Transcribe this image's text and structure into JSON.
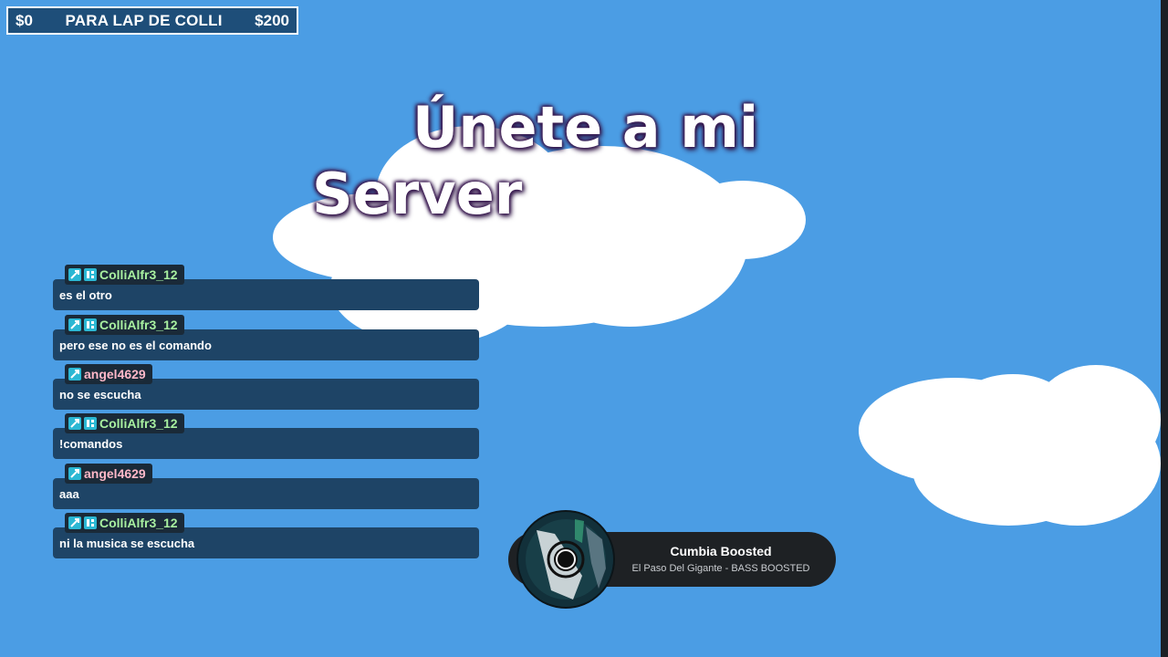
{
  "goal": {
    "current": "$0",
    "title": "PARA LAP DE COLLI",
    "target": "$200"
  },
  "headline": {
    "line1": "Únete a mi",
    "line2": "Server"
  },
  "chat": {
    "messages": [
      {
        "user": "ColliAlfr3_12",
        "text": "es el otro",
        "user_color": "#a8f0a0"
      },
      {
        "user": "ColliAlfr3_12",
        "text": "pero ese no es el comando",
        "user_color": "#a8f0a0"
      },
      {
        "user": "angel4629",
        "text": "no se escucha",
        "user_color": "#ffb8c8"
      },
      {
        "user": "ColliAlfr3_12",
        "text": "!comandos",
        "user_color": "#a8f0a0"
      },
      {
        "user": "angel4629",
        "text": "aaa",
        "user_color": "#ffb8c8"
      },
      {
        "user": "ColliAlfr3_12",
        "text": "ni la musica se escucha",
        "user_color": "#a8f0a0"
      }
    ]
  },
  "now_playing": {
    "title": "Cumbia Boosted",
    "subtitle": "El Paso Del Gigante - BASS BOOSTED"
  },
  "colors": {
    "sky": "#4b9de4",
    "chat_bg": "#1e4466",
    "badge": "#2bb8d4"
  },
  "icons": {
    "badge1": "moderator-sword-icon",
    "badge2": "bot-badge-icon",
    "disc": "vinyl-disc-icon"
  }
}
